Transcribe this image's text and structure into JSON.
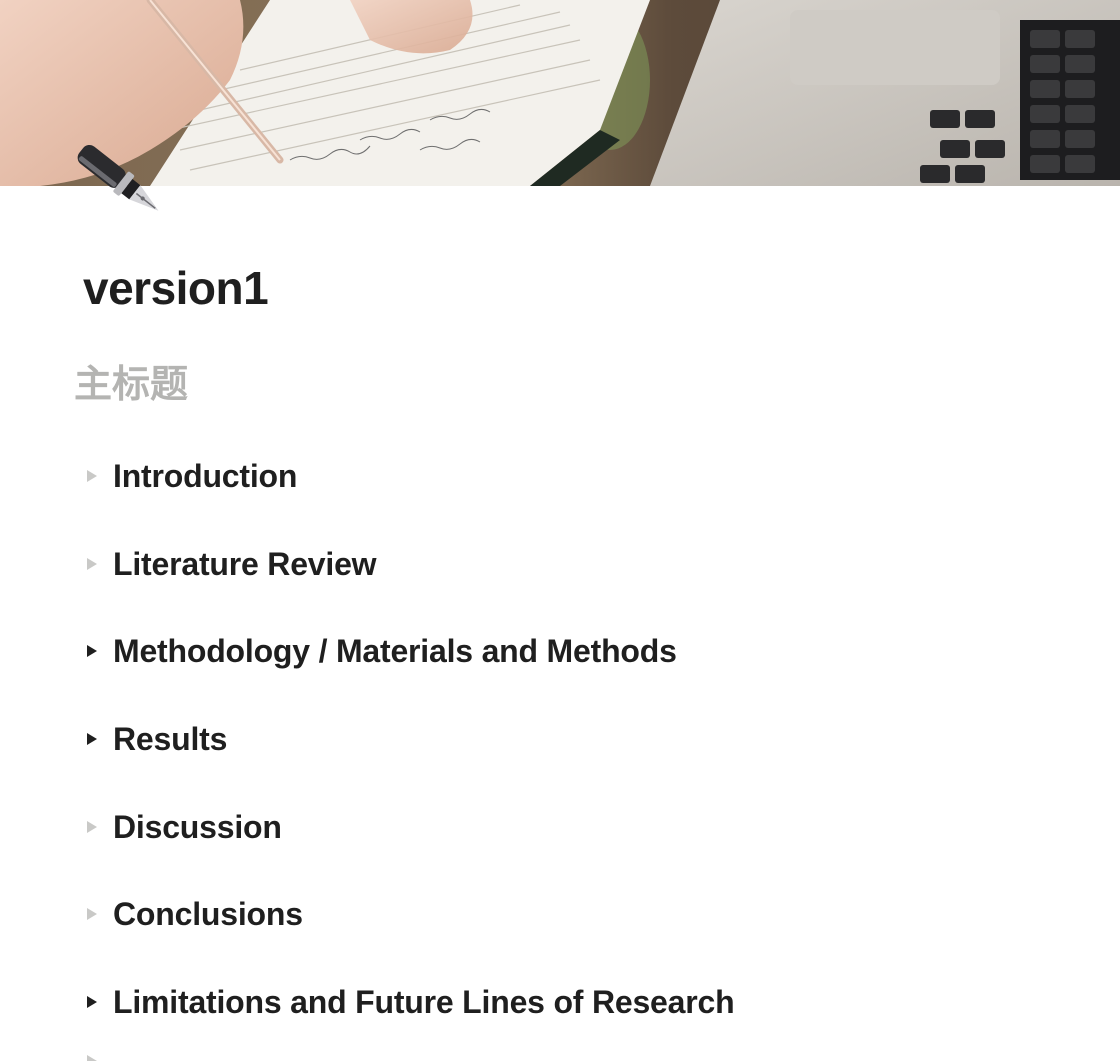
{
  "cover": {
    "description_icon": "notebook-writing-cover-image"
  },
  "page_icon": "fountain-pen-icon",
  "title": "version1",
  "main_heading": "主标题",
  "toggles": [
    {
      "label": "Introduction",
      "has_content": false
    },
    {
      "label": "Literature Review",
      "has_content": false
    },
    {
      "label": "Methodology / Materials and Methods",
      "has_content": true
    },
    {
      "label": "Results",
      "has_content": true
    },
    {
      "label": "Discussion",
      "has_content": false
    },
    {
      "label": "Conclusions",
      "has_content": false
    },
    {
      "label": "Limitations and Future Lines of Research",
      "has_content": true
    }
  ],
  "colors": {
    "arrow_filled": "#1f1f1f",
    "arrow_empty": "#c9c9c7",
    "heading_placeholder": "#b4b4b2",
    "text": "#1f1f1f"
  }
}
